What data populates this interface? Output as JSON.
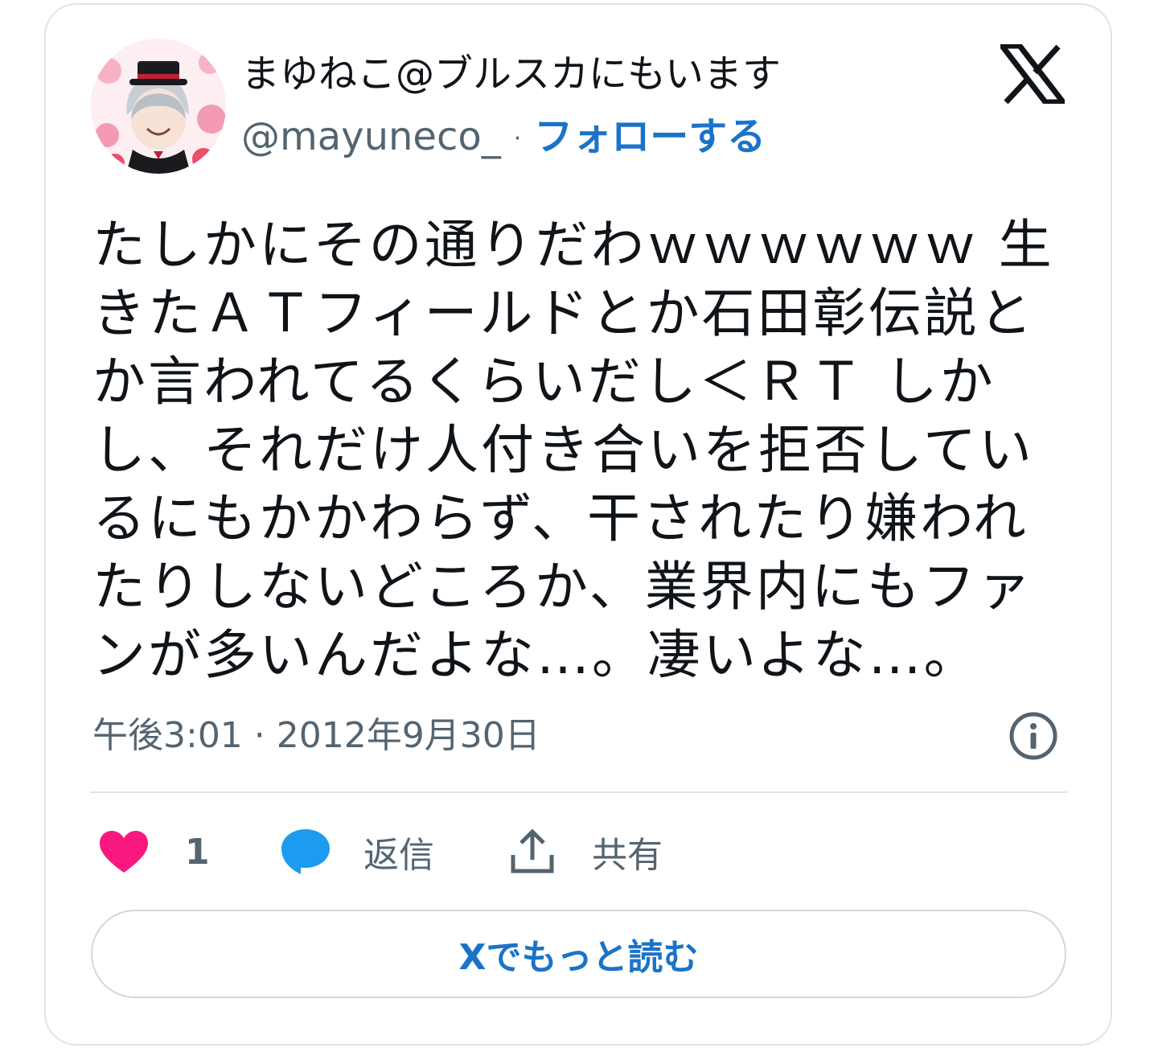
{
  "author": {
    "display_name": "まゆねこ@ブルスカにもいます",
    "handle": "@mayuneco_",
    "separator": "·",
    "follow_label": "フォローする"
  },
  "tweet": {
    "text": "たしかにその通りだわｗｗｗｗｗｗ 生きたＡＴフィールドとか石田彰伝説とか言われてるくらいだし＜ＲＴ しかし、それだけ人付き合いを拒否しているにもかかわらず、干されたり嫌われたりしないどころか、業界内にもファンが多いんだよな…。凄いよな…。",
    "timestamp": "午後3:01 · 2012年9月30日"
  },
  "actions": {
    "like_count": "1",
    "reply_label": "返信",
    "share_label": "共有"
  },
  "read_more_label": "Xでもっと読む",
  "icons": {
    "logo": "x-logo-icon",
    "info": "info-icon",
    "like": "heart-icon",
    "reply": "speech-bubble-icon",
    "share": "share-upload-icon"
  },
  "colors": {
    "like": "#f91880",
    "reply": "#1d9bf0",
    "link": "#1a73c9",
    "muted": "#536471",
    "border": "#dfe3e7"
  }
}
